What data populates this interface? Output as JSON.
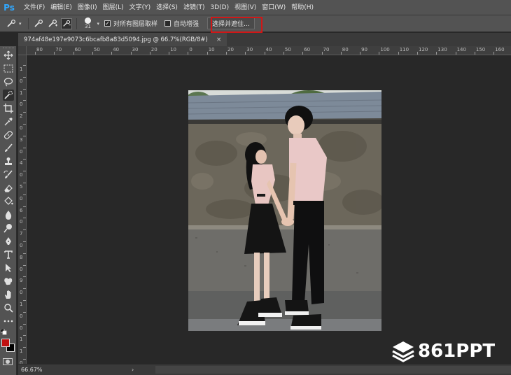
{
  "app": {
    "logo": "Ps"
  },
  "menu": [
    "文件(F)",
    "编辑(E)",
    "图像(I)",
    "图层(L)",
    "文字(Y)",
    "选择(S)",
    "滤镜(T)",
    "3D(D)",
    "视图(V)",
    "窗口(W)",
    "帮助(H)"
  ],
  "options": {
    "brush_size": "31",
    "sample_all_layers": {
      "label": "对所有图层取样",
      "checked": true
    },
    "auto_enhance": {
      "label": "自动增强",
      "checked": false
    },
    "select_and_mask": "选择并遮住..."
  },
  "document": {
    "tab_title": "974af48e197e9073c6bcafb8a83d5094.jpg @ 66.7%(RGB/8#)",
    "close_glyph": "×"
  },
  "ruler": {
    "top_labels": [
      "80",
      "70",
      "60",
      "50",
      "40",
      "30",
      "20",
      "10",
      "0",
      "10",
      "20",
      "30",
      "40",
      "50",
      "60",
      "70",
      "80",
      "90",
      "100",
      "110",
      "120",
      "130",
      "140",
      "150",
      "160"
    ],
    "left_labels": [
      "1",
      "0",
      "1",
      "0",
      "2",
      "0",
      "3",
      "0",
      "4",
      "0",
      "5",
      "0",
      "6",
      "0",
      "7",
      "0",
      "8",
      "0",
      "9",
      "0",
      "1",
      "0",
      "0",
      "1",
      "1",
      "0"
    ]
  },
  "status": {
    "zoom": "66.67%",
    "arrow": "›"
  },
  "watermark": {
    "text": "861PPT"
  },
  "colors": {
    "foreground": "#c01010",
    "background": "#000000",
    "highlight": "#d01717",
    "ps_blue": "#31a8ff"
  },
  "tools": [
    "move-icon",
    "marquee-icon",
    "lasso-icon",
    "quick-selection-icon",
    "crop-icon",
    "eyedropper-icon",
    "healing-brush-icon",
    "brush-icon",
    "clone-stamp-icon",
    "history-brush-icon",
    "eraser-icon",
    "paint-bucket-icon",
    "blur-icon",
    "dodge-icon",
    "pen-icon",
    "type-icon",
    "path-selection-icon",
    "shape-icon",
    "hand-icon",
    "zoom-icon",
    "more-tools-icon"
  ]
}
